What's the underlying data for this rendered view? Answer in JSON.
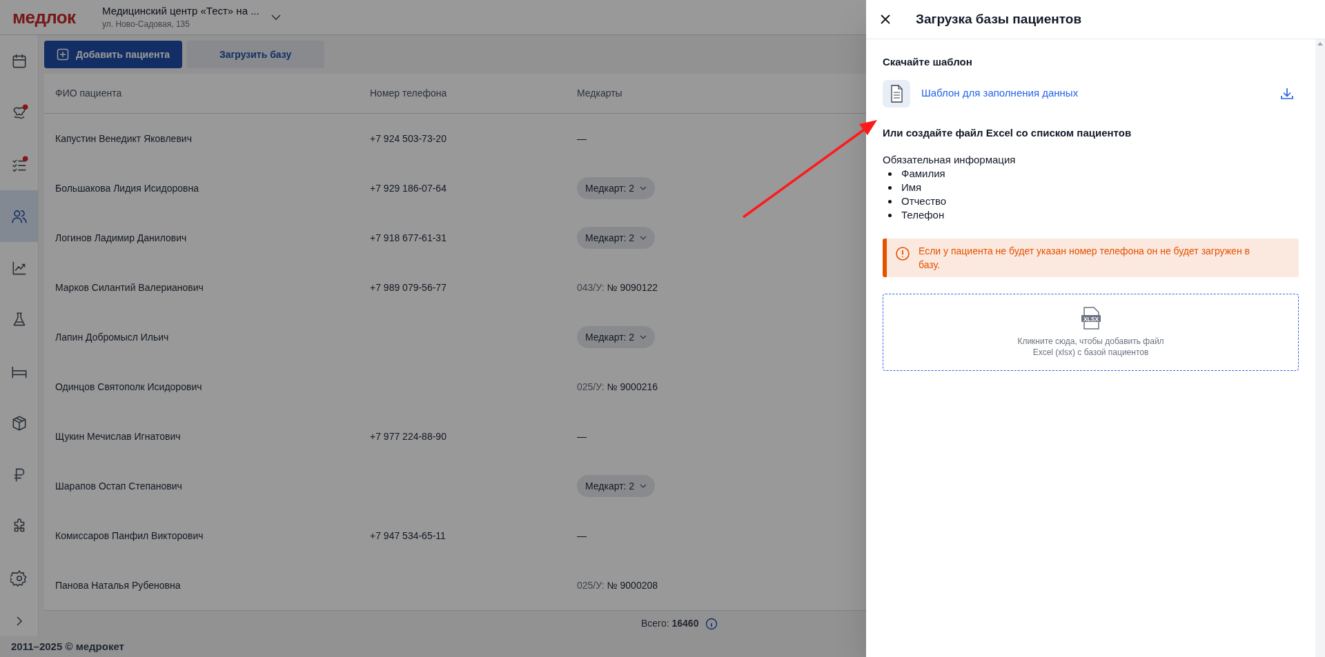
{
  "header": {
    "logo": "медлок",
    "clinic_name": "Медицинский центр «Тест» на ...",
    "clinic_address": "ул. Ново-Садовая, 135"
  },
  "sidebar": {
    "items": [
      {
        "selected": false,
        "badge": false
      },
      {
        "selected": false,
        "badge": true
      },
      {
        "selected": false,
        "badge": true
      },
      {
        "selected": true,
        "badge": false
      },
      {
        "selected": false,
        "badge": false
      },
      {
        "selected": false,
        "badge": false
      },
      {
        "selected": false,
        "badge": false
      },
      {
        "selected": false,
        "badge": false
      },
      {
        "selected": false,
        "badge": false
      },
      {
        "selected": false,
        "badge": false
      },
      {
        "selected": false,
        "badge": false
      }
    ]
  },
  "toolbar": {
    "add_button": "Добавить пациента",
    "upload_button": "Загрузить базу"
  },
  "table": {
    "columns": [
      "ФИО пациента",
      "Номер телефона",
      "Медкарты"
    ],
    "rows": [
      {
        "name": "Капустин Венедикт Яковлевич",
        "phone": "+7 924 503-73-20",
        "card": {
          "kind": "dash",
          "text": "—"
        }
      },
      {
        "name": "Большакова Лидия Исидоровна",
        "phone": "+7 929 186-07-64",
        "card": {
          "kind": "dropdown",
          "text": "Медкарт: 2"
        }
      },
      {
        "name": "Логинов Ладимир Данилович",
        "phone": "+7 918 677-61-31",
        "card": {
          "kind": "dropdown",
          "text": "Медкарт: 2"
        }
      },
      {
        "name": "Марков Силантий Валерианович",
        "phone": "+7 989 079-56-77",
        "card": {
          "kind": "record",
          "prefix": "043/У:",
          "text": "№ 9090122"
        }
      },
      {
        "name": "Лапин Добромысл Ильич",
        "card": {
          "kind": "dropdown",
          "text": "Медкарт: 2"
        }
      },
      {
        "name": "Одинцов Святополк Исидорович",
        "card": {
          "kind": "record",
          "prefix": "025/У:",
          "text": "№ 9000216"
        }
      },
      {
        "name": "Щукин Мечислав Игнатович",
        "phone": "+7 977 224-88-90",
        "card": {
          "kind": "dash",
          "text": "—"
        }
      },
      {
        "name": "Шарапов Остап Степанович",
        "card": {
          "kind": "dropdown",
          "text": "Медкарт: 2"
        }
      },
      {
        "name": "Комиссаров Панфил Викторович",
        "phone": "+7 947 534-65-11",
        "card": {
          "kind": "dash",
          "text": "—"
        }
      },
      {
        "name": "Панова Наталья Рубеновна",
        "card": {
          "kind": "record",
          "prefix": "025/У:",
          "text": "№ 9000208"
        }
      }
    ],
    "total_label": "Всего:",
    "total_value": "16460"
  },
  "footer": "2011–2025 © медрокет",
  "drawer": {
    "title": "Загрузка базы пациентов",
    "template_heading": "Скачайте шаблон",
    "template_link": "Шаблон для заполнения данных",
    "create_heading": "Или создайте файл Excel со списком пациентов",
    "required_label": "Обязательная информация",
    "required_fields": [
      "Фамилия",
      "Имя",
      "Отчество",
      "Телефон"
    ],
    "warning": "Если у пациента не будет указан номер телефона он не будет загружен в базу.",
    "dropzone_badge": "XLSX",
    "dropzone_lines": [
      "Кликните сюда, чтобы добавить файл",
      "Excel (xlsx) с базой пациентов"
    ]
  }
}
